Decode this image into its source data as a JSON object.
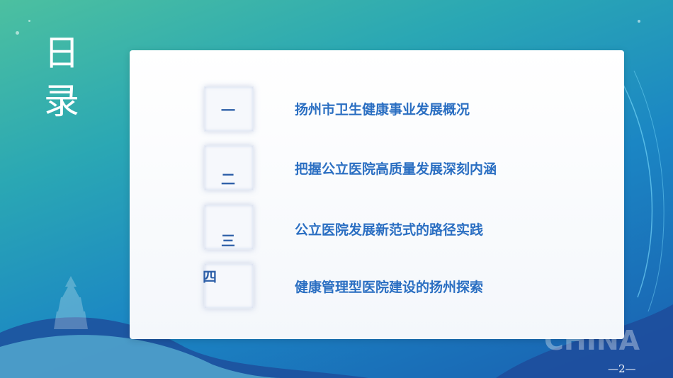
{
  "heading": {
    "line1": "日",
    "line2": "录"
  },
  "items": [
    {
      "num": "一",
      "text": "扬州市卫生健康事业发展概况"
    },
    {
      "num": "二",
      "text": "把握公立医院高质量发展深刻内涵"
    },
    {
      "num": "三",
      "text": "公立医院发展新范式的路径实践"
    },
    {
      "num": "四",
      "text": "健康管理型医院建设的扬州探索"
    }
  ],
  "watermark": "CHINA",
  "page_number": "—2—",
  "colors": {
    "accent": "#2b6fc2",
    "number": "#2d5fa8",
    "background_top": "#4cc0a0",
    "background_bottom": "#1a5fb0"
  }
}
